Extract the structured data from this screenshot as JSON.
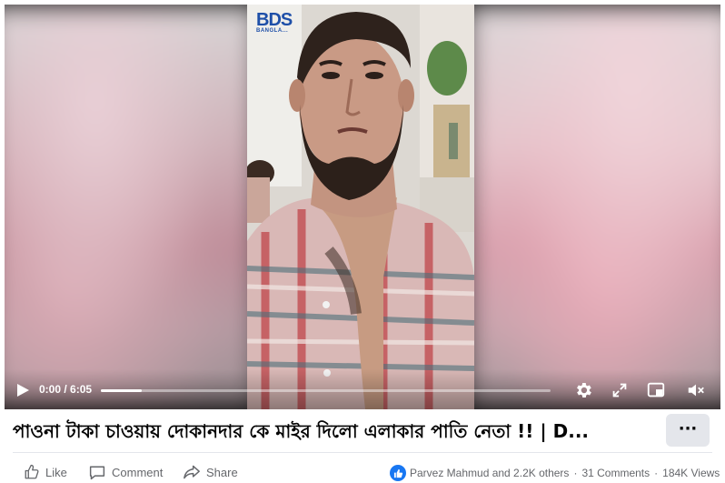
{
  "player": {
    "current_time": "0:00",
    "duration": "6:05",
    "time_display": "0:00 / 6:05",
    "progress_fraction": 0.09,
    "logo_text": "BDS",
    "logo_subtext": "BANGLA..."
  },
  "post": {
    "title": "পাওনা টাকা চাওয়ায় দোকানদার কে মাইর দিলো এলাকার পাতি নেতা !! | D...",
    "more_label": "···"
  },
  "actions": {
    "like": "Like",
    "comment": "Comment",
    "share": "Share"
  },
  "stats": {
    "reactors": "Parvez Mahmud and 2.2K others",
    "comments": "31 Comments",
    "views": "184K Views",
    "separator": "·"
  },
  "colors": {
    "accent": "#1877f2",
    "text_primary": "#050505",
    "text_secondary": "#65676b"
  },
  "icons": [
    "play-icon",
    "settings-icon",
    "fullscreen-icon",
    "picture-in-picture-icon",
    "volume-muted-icon",
    "like-icon",
    "comment-icon",
    "share-icon",
    "like-reaction-icon"
  ]
}
